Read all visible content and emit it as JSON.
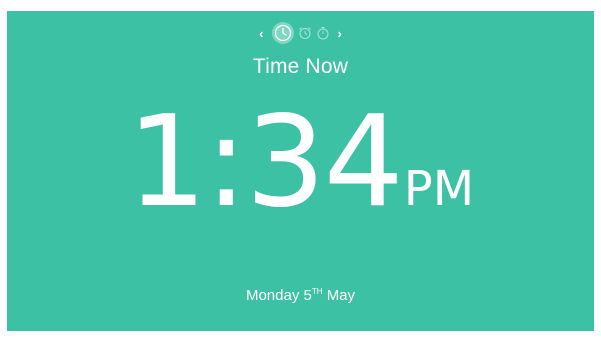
{
  "nav": {
    "prev_glyph": "‹",
    "next_glyph": "›",
    "modes": [
      {
        "icon": "clock-icon",
        "active": true
      },
      {
        "icon": "alarm-icon",
        "active": false
      },
      {
        "icon": "stopwatch-icon",
        "active": false
      }
    ]
  },
  "title": "Time Now",
  "clock": {
    "time": "1:34",
    "period": "PM"
  },
  "date": {
    "weekday": "Monday",
    "day": "5",
    "suffix": "TH",
    "month": "May"
  },
  "colors": {
    "background": "#3cc1a4",
    "text": "#ffffff"
  }
}
